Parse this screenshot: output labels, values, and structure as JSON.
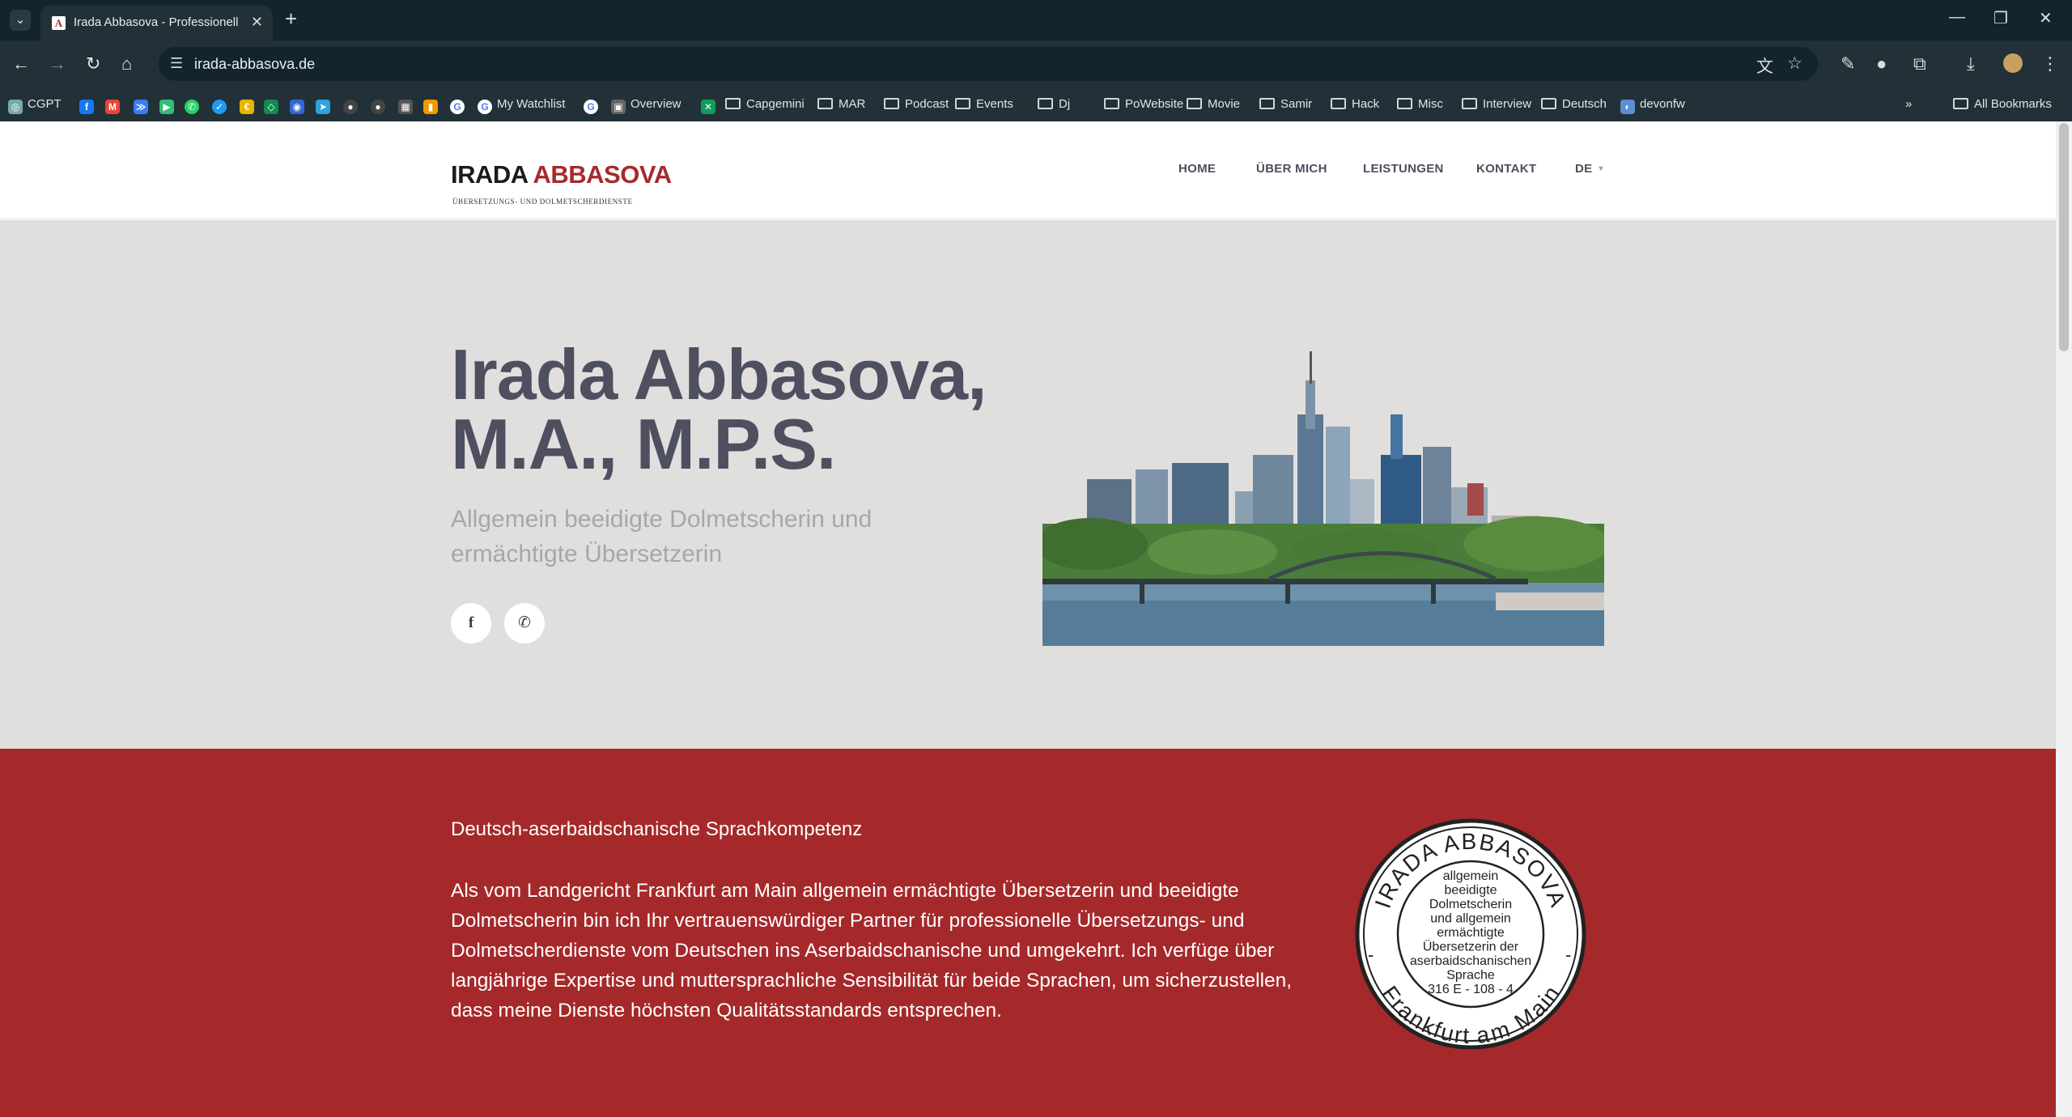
{
  "browser": {
    "tab_title": "Irada Abbasova - Professionell",
    "url": "irada-abbasova.de",
    "bookmarks": [
      {
        "label": "CGPT",
        "icon": "chatgpt-icon"
      },
      {
        "label": "",
        "icon": "facebook-icon"
      },
      {
        "label": "",
        "icon": "gmail-icon"
      },
      {
        "label": "",
        "icon": "messenger-icon"
      },
      {
        "label": "",
        "icon": "google-play-icon"
      },
      {
        "label": "",
        "icon": "whatsapp-icon"
      },
      {
        "label": "",
        "icon": "check-icon"
      },
      {
        "label": "",
        "icon": "euro-icon"
      },
      {
        "label": "",
        "icon": "app-icon"
      },
      {
        "label": "",
        "icon": "globe-icon"
      },
      {
        "label": "",
        "icon": "telegram-icon"
      },
      {
        "label": "",
        "icon": "github-icon"
      },
      {
        "label": "",
        "icon": "github-icon"
      },
      {
        "label": "",
        "icon": "grid-icon"
      },
      {
        "label": "",
        "icon": "analytics-icon"
      },
      {
        "label": "",
        "icon": "google-icon"
      },
      {
        "label": "My Watchlist",
        "icon": "google-icon"
      },
      {
        "label": "",
        "icon": "google-icon"
      },
      {
        "label": "Overview",
        "icon": "dashboard-icon"
      },
      {
        "label": "",
        "icon": "close-x-icon"
      },
      {
        "label": "Capgemini",
        "icon": "folder-icon"
      },
      {
        "label": "MAR",
        "icon": "folder-icon"
      },
      {
        "label": "Podcast",
        "icon": "folder-icon"
      },
      {
        "label": "Events",
        "icon": "folder-icon"
      },
      {
        "label": "Dj",
        "icon": "folder-icon"
      },
      {
        "label": "PoWebsite",
        "icon": "folder-icon"
      },
      {
        "label": "Movie",
        "icon": "folder-icon"
      },
      {
        "label": "Samir",
        "icon": "folder-icon"
      },
      {
        "label": "Hack",
        "icon": "folder-icon"
      },
      {
        "label": "Misc",
        "icon": "folder-icon"
      },
      {
        "label": "Interview",
        "icon": "folder-icon"
      },
      {
        "label": "Deutsch",
        "icon": "folder-icon"
      },
      {
        "label": "devonfw",
        "icon": "devonfw-icon"
      }
    ],
    "more_bookmarks": "»",
    "all_bookmarks": "All Bookmarks"
  },
  "site": {
    "logo_first": "IRADA",
    "logo_last": "ABBASOVA",
    "logo_sub": "ÜBERSETZUNGS- UND DOLMETSCHERDIENSTE",
    "nav": {
      "home": "HOME",
      "about": "ÜBER MICH",
      "services": "LEISTUNGEN",
      "contact": "KONTAKT",
      "lang": "DE"
    },
    "hero": {
      "title_line1": "Irada Abbasova,",
      "title_line2": "M.A., M.P.S.",
      "subtitle": "Allgemein beeidigte Dolmetscherin und ermächtigte Übersetzerin",
      "social_facebook": "f",
      "social_whatsapp": "✆"
    },
    "about": {
      "heading": "Deutsch-aserbaidschanische Sprachkompetenz",
      "text": "Als vom Landgericht Frankfurt am Main allgemein ermächtigte Übersetzerin und beeidigte Dolmetscherin bin ich Ihr vertrauenswürdiger Partner für professionelle Übersetzungs- und Dolmetscherdienste vom Deutschen ins Aserbaidschanische und umgekehrt. Ich verfüge über langjährige Expertise und muttersprachliche Sensibilität für beide Sprachen, um sicherzustellen, dass meine Dienste höchsten Qualitätsstandards entsprechen."
    },
    "seal": {
      "top_arc": "IRADA ABBASOVA",
      "bottom_arc": "Frankfurt am Main",
      "lines": [
        "allgemein",
        "beeidigte",
        "Dolmetscherin",
        "und allgemein",
        "ermächtigte",
        "Übersetzerin der",
        "aserbaidschanischen",
        "Sprache",
        "316 E - 108 - 4"
      ]
    }
  },
  "colors": {
    "brand_red": "#a5292a",
    "hero_bg": "#e1dfde",
    "title_gray": "#4e5060"
  }
}
